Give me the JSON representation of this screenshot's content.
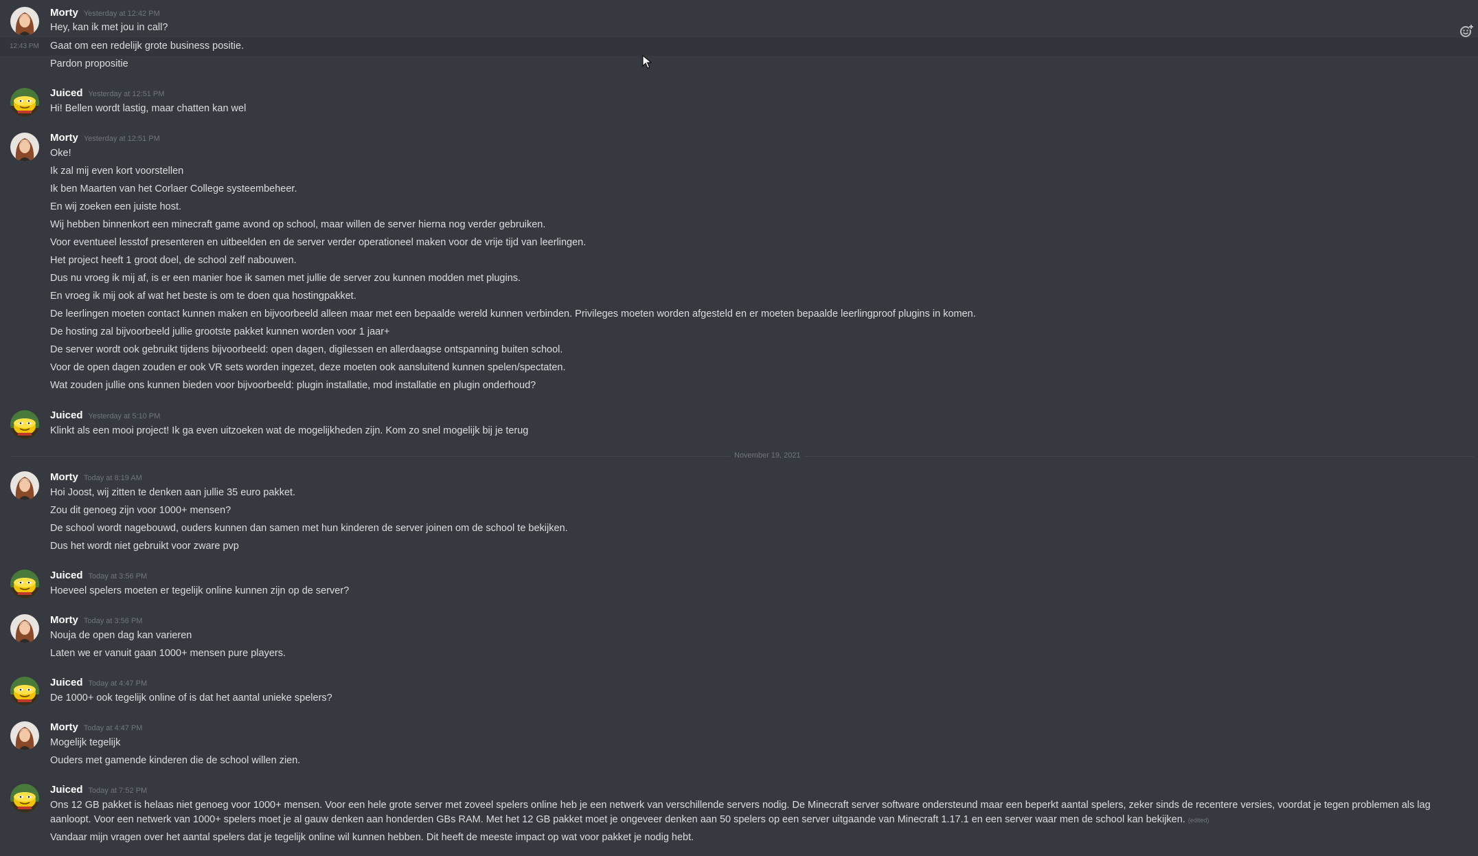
{
  "users": {
    "morty": "Morty",
    "juiced": "Juiced"
  },
  "groups": [
    {
      "user": "Morty",
      "time": "Yesterday at 12:42 PM",
      "lines": [
        "Hey, kan ik met jou in call?",
        "Gaat om een redelijk grote business positie.",
        "Pardon propositie"
      ],
      "hover_time": "12:43 PM"
    },
    {
      "user": "Juiced",
      "time": "Yesterday at 12:51 PM",
      "lines": [
        "Hi! Bellen wordt lastig, maar chatten kan wel"
      ]
    },
    {
      "user": "Morty",
      "time": "Yesterday at 12:51 PM",
      "lines": [
        "Oke!",
        "Ik zal mij even kort voorstellen",
        "Ik ben Maarten van het Corlaer College systeembeheer.",
        "En wij zoeken een juiste host.",
        "Wij hebben binnenkort een minecraft game avond op school, maar willen de server hierna nog verder gebruiken.",
        "Voor eventueel lesstof presenteren en uitbeelden en de server verder operationeel maken voor de vrije tijd van leerlingen.",
        "Het project heeft 1 groot doel, de school zelf nabouwen.",
        "Dus nu vroeg ik mij af, is er een manier hoe ik samen met jullie de server zou kunnen modden met plugins.",
        "En vroeg ik mij ook af wat het beste is om te doen qua hostingpakket.",
        "De leerlingen moeten contact kunnen maken en bijvoorbeeld alleen maar met een bepaalde wereld kunnen verbinden. Privileges moeten worden afgesteld en er moeten bepaalde leerlingproof plugins in komen.",
        "De hosting zal bijvoorbeeld jullie grootste pakket kunnen worden voor 1 jaar+",
        "De server wordt ook gebruikt tijdens bijvoorbeeld: open dagen, digilessen en allerdaagse ontspanning buiten school.",
        "Voor de open dagen zouden er ook VR sets worden ingezet, deze moeten ook aansluitend kunnen spelen/spectaten.",
        "Wat zouden jullie ons kunnen bieden voor bijvoorbeeld: plugin installatie, mod installatie en plugin onderhoud?"
      ]
    },
    {
      "user": "Juiced",
      "time": "Yesterday at 5:10 PM",
      "lines": [
        "Klinkt als een mooi project! Ik ga even uitzoeken wat de mogelijkheden zijn. Kom zo snel mogelijk bij je terug"
      ]
    },
    {
      "user": "Morty",
      "time": "Today at 8:19 AM",
      "lines": [
        "Hoi Joost, wij zitten te denken aan jullie 35 euro pakket.",
        "Zou dit genoeg zijn voor 1000+ mensen?",
        "De school wordt nagebouwd, ouders kunnen dan samen met hun kinderen de server joinen om de school te bekijken.",
        "Dus het wordt niet gebruikt voor zware pvp"
      ]
    },
    {
      "user": "Juiced",
      "time": "Today at 3:56 PM",
      "lines": [
        "Hoeveel spelers moeten er tegelijk online kunnen zijn op de server?"
      ]
    },
    {
      "user": "Morty",
      "time": "Today at 3:56 PM",
      "lines": [
        "Nouja de open dag kan varieren",
        "Laten we er vanuit gaan 1000+ mensen pure players."
      ]
    },
    {
      "user": "Juiced",
      "time": "Today at 4:47 PM",
      "lines": [
        "De 1000+ ook tegelijk online of is dat het aantal unieke spelers?"
      ]
    },
    {
      "user": "Morty",
      "time": "Today at 4:47 PM",
      "lines": [
        "Mogelijk tegelijk",
        "Ouders met gamende kinderen die de school willen zien."
      ]
    },
    {
      "user": "Juiced",
      "time": "Today at 7:52 PM",
      "lines": [
        "Ons 12 GB pakket is helaas niet genoeg voor 1000+ mensen. Voor een hele grote server met zoveel spelers online heb je een netwerk van verschillende servers nodig. De Minecraft server software ondersteund maar een beperkt aantal spelers, zeker sinds de recentere versies, voordat je tegen problemen als lag aanloopt. Voor een netwerk van 1000+ spelers moet je al gauw denken aan honderden GBs RAM. Met het 12 GB pakket moet je ongeveer denken aan 50 spelers op een server uitgaande van Minecraft 1.17.1 en een server waar men de school kan bekijken.",
        "Vandaar mijn vragen over het aantal spelers dat je tegelijk online wil kunnen hebben. Dit heeft de meeste impact op wat voor pakket je nodig hebt."
      ],
      "edited_label": "(edited)"
    }
  ],
  "date_divider": "November 19, 2021",
  "icons": {
    "add_reaction": "add-reaction-icon",
    "cursor": "mouse-pointer"
  }
}
